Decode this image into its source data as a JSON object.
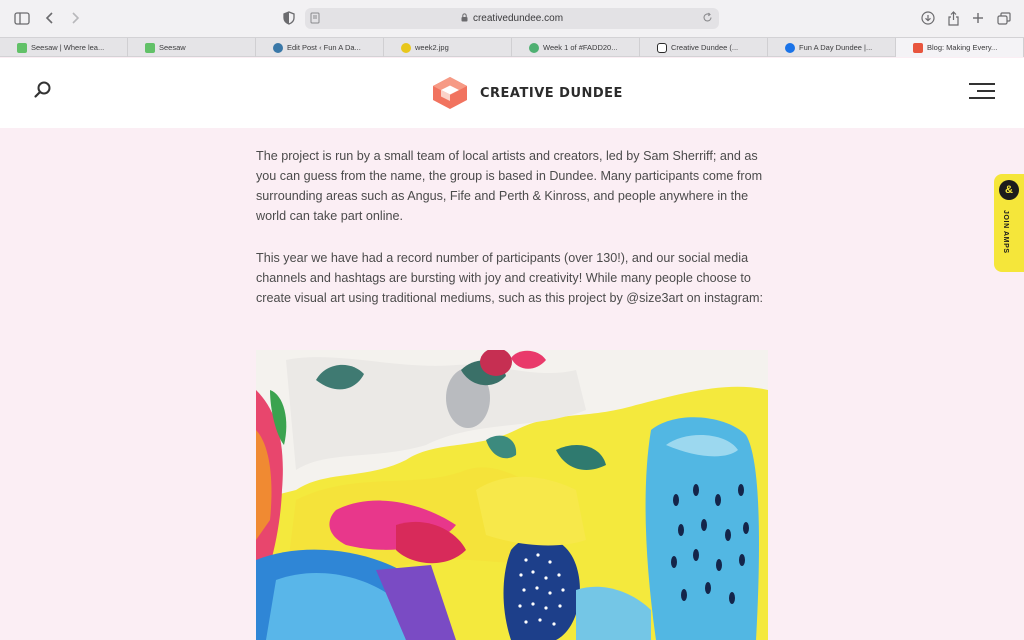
{
  "browser": {
    "url": "creativedundee.com",
    "tabs": [
      {
        "title": "Seesaw | Where lea...",
        "favicon_color": "#62c168"
      },
      {
        "title": "Seesaw",
        "favicon_color": "#62c168"
      },
      {
        "title": "Edit Post ‹ Fun A Da...",
        "favicon_color": "#3a78a8"
      },
      {
        "title": "week2.jpg",
        "favicon_color": "#e8c71c"
      },
      {
        "title": "Week 1 of #FADD20...",
        "favicon_color": "#4fb072"
      },
      {
        "title": "Creative Dundee (...",
        "favicon_color": "#2b2b2b"
      },
      {
        "title": "Fun A Day Dundee |...",
        "favicon_color": "#1a73e8"
      },
      {
        "title": "Blog: Making Every...",
        "favicon_color": "#e8553e"
      }
    ]
  },
  "site": {
    "logo_text": "CREATIVE DUNDEE",
    "brand_color": "#f1735f"
  },
  "article": {
    "paragraphs": [
      "The project is run by a small team of local artists and creators, led by Sam Sherriff; and as you can guess from the name, the group is based in Dundee. Many participants come from surrounding areas such as Angus, Fife and Perth & Kinross, and people anywhere in the world can take part online.",
      "This year we have had a record number of participants (over 130!), and our social media channels and hashtags are bursting with joy and creativity! While many people choose to create visual art using traditional mediums, such as this project by @size3art on instagram:"
    ]
  },
  "side_tab": {
    "label": "JOIN AMPS",
    "icon": "amp-icon"
  }
}
